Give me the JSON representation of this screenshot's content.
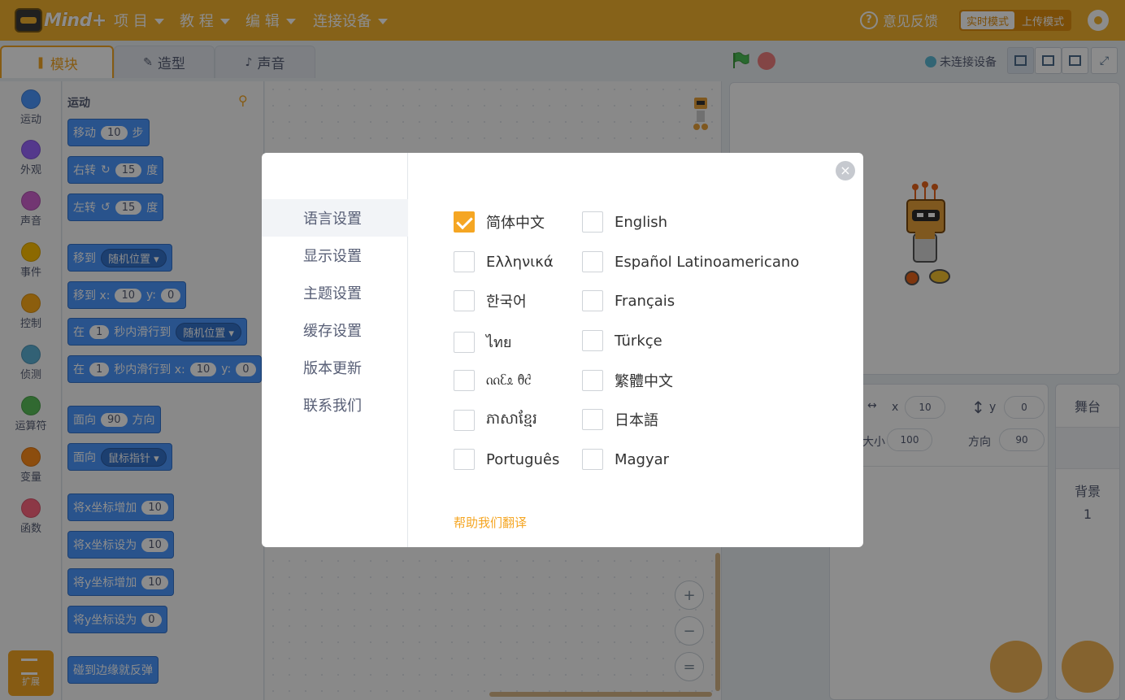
{
  "app": {
    "logo_text": "Mind+"
  },
  "menu": {
    "items": [
      {
        "label": "项 目"
      },
      {
        "label": "教 程"
      },
      {
        "label": "编 辑"
      },
      {
        "label": "连接设备"
      }
    ],
    "feedback": "意见反馈",
    "mode_realtime": "实时模式",
    "mode_upload": "上传模式"
  },
  "tabs": [
    {
      "label": "模块",
      "icon": "blocks-icon"
    },
    {
      "label": "造型",
      "icon": "brush-icon"
    },
    {
      "label": "声音",
      "icon": "speaker-icon"
    }
  ],
  "connection_status": "未连接设备",
  "categories": [
    {
      "label": "运动",
      "color": "#4c97ff"
    },
    {
      "label": "外观",
      "color": "#9966ff"
    },
    {
      "label": "声音",
      "color": "#cf63cf"
    },
    {
      "label": "事件",
      "color": "#ffbf00"
    },
    {
      "label": "控制",
      "color": "#ffab19"
    },
    {
      "label": "侦测",
      "color": "#5cb1d6"
    },
    {
      "label": "运算符",
      "color": "#59c059"
    },
    {
      "label": "变量",
      "color": "#ff8c1a"
    },
    {
      "label": "函数",
      "color": "#ff6680"
    }
  ],
  "extension_label": "扩展",
  "palette": {
    "title": "运动",
    "blocks": {
      "move": {
        "pre": "移动",
        "val": "10",
        "post": "步"
      },
      "turn_right": {
        "pre": "右转",
        "val": "15",
        "post": "度"
      },
      "turn_left": {
        "pre": "左转",
        "val": "15",
        "post": "度"
      },
      "goto": {
        "pre": "移到",
        "drop": "随机位置"
      },
      "goto_xy": {
        "pre": "移到 x:",
        "x": "10",
        "ylabel": "y:",
        "y": "0"
      },
      "glide": {
        "pre": "在",
        "val": "1",
        "mid": "秒内滑行到",
        "drop": "随机位置"
      },
      "glide_xy": {
        "pre": "在",
        "val": "1",
        "mid": "秒内滑行到 x:",
        "x": "10",
        "ylabel": "y:",
        "y": "0"
      },
      "point_dir": {
        "pre": "面向",
        "val": "90",
        "post": "方向"
      },
      "point_towards": {
        "pre": "面向",
        "drop": "鼠标指针"
      },
      "change_x": {
        "pre": "将x坐标增加",
        "val": "10"
      },
      "set_x": {
        "pre": "将x坐标设为",
        "val": "10"
      },
      "change_y": {
        "pre": "将y坐标增加",
        "val": "10"
      },
      "set_y": {
        "pre": "将y坐标设为",
        "val": "0"
      },
      "bounce": {
        "pre": "碰到边缘就反弹"
      }
    }
  },
  "sprite_info": {
    "x_label": "x",
    "x_value": "10",
    "y_label": "y",
    "y_value": "0",
    "size_label": "大小",
    "size_value": "100",
    "direction_label": "方向",
    "direction_value": "90"
  },
  "stage_panel": {
    "title": "舞台",
    "backdrop_label": "背景",
    "backdrop_count": "1"
  },
  "zoom": {
    "in": "+",
    "out": "−",
    "reset": "="
  },
  "settings_modal": {
    "nav": [
      {
        "label": "语言设置",
        "active": true
      },
      {
        "label": "显示设置"
      },
      {
        "label": "主题设置"
      },
      {
        "label": "缓存设置"
      },
      {
        "label": "版本更新"
      },
      {
        "label": "联系我们"
      }
    ],
    "close": "×",
    "languages_left": [
      {
        "label": "简体中文",
        "checked": true
      },
      {
        "label": "Ελληνικά"
      },
      {
        "label": "한국어"
      },
      {
        "label": "ไทย"
      },
      {
        "label": "ᦶᦷᦸ ᦹᦺ"
      },
      {
        "label": "ភាសាខ្មែរ"
      },
      {
        "label": "Português"
      }
    ],
    "languages_right": [
      {
        "label": "English"
      },
      {
        "label": "Español Latinoamericano"
      },
      {
        "label": "Français"
      },
      {
        "label": "Türkçe"
      },
      {
        "label": "繁體中文"
      },
      {
        "label": "日本語"
      },
      {
        "label": "Magyar"
      }
    ],
    "help_translate": "帮助我们翻译"
  }
}
